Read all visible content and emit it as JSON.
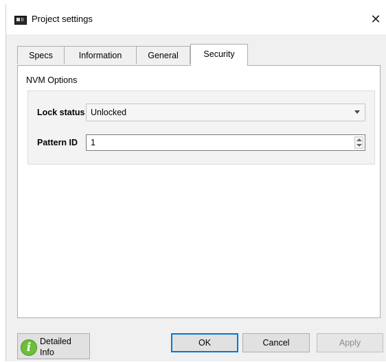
{
  "window": {
    "title": "Project settings",
    "close_glyph": "✕",
    "icon": "project-app-icon"
  },
  "tabs": [
    {
      "label": "Specs",
      "active": false
    },
    {
      "label": "Information",
      "active": false
    },
    {
      "label": "General",
      "active": false
    },
    {
      "label": "Security",
      "active": true
    }
  ],
  "security": {
    "group_title": "NVM Options",
    "lock_status": {
      "label": "Lock status",
      "value": "Unlocked"
    },
    "pattern_id": {
      "label": "Pattern ID",
      "value": "1"
    }
  },
  "footer": {
    "info_button": {
      "label": "Detailed\nInfo",
      "icon": "info-icon",
      "icon_glyph": "i"
    },
    "ok_label": "OK",
    "cancel_label": "Cancel",
    "apply_label": "Apply",
    "apply_enabled": false
  },
  "colors": {
    "accent": "#0078d7",
    "info_icon": "#6cbf3a",
    "dialog_bg": "#f0f0f0"
  }
}
